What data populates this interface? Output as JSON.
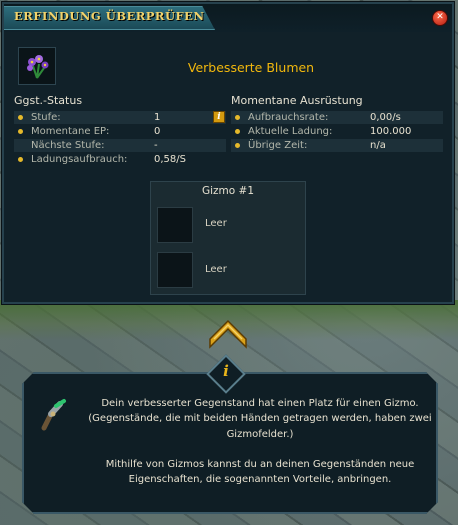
{
  "window": {
    "title": "ERFINDUNG ÜBERPRÜFEN",
    "close_icon": "close-icon",
    "accent": "#f2b80d"
  },
  "item": {
    "name": "Verbesserte Blumen",
    "icon": "flowers-icon"
  },
  "item_status": {
    "heading": "Ggst.-Status",
    "rows": [
      {
        "label": "Stufe:",
        "value": "1",
        "bullet": true,
        "info_icon": true
      },
      {
        "label": "Momentane EP:",
        "value": "0",
        "bullet": true
      },
      {
        "label": "Nächste Stufe:",
        "value": "-",
        "bullet": false
      },
      {
        "label": "Ladungsaufbrauch:",
        "value": "0,58/S",
        "bullet": true
      }
    ]
  },
  "current_equipment": {
    "heading": "Momentane Ausrüstung",
    "rows": [
      {
        "label": "Aufbrauchsrate:",
        "value": "0,00/s",
        "bullet": true
      },
      {
        "label": "Aktuelle Ladung:",
        "value": "100.000",
        "bullet": true
      },
      {
        "label": "Übrige Zeit:",
        "value": "n/a",
        "bullet": true
      }
    ]
  },
  "gizmo": {
    "title": "Gizmo #1",
    "slots": [
      {
        "label": "Leer"
      },
      {
        "label": "Leer"
      }
    ]
  },
  "arrow": {
    "icon": "chevron-up-icon"
  },
  "info": {
    "icon": "info-icon",
    "tool_icon": "invention-tool-icon",
    "paragraph1": "Dein verbesserter Gegenstand hat einen Platz für einen Gizmo. (Gegenstände, die mit beiden Händen getragen werden, haben zwei Gizmofelder.)",
    "paragraph2": "Mithilfe von Gizmos kannst du an deinen Gegenständen neue Eigenschaften, die sogenannten Vorteile, anbringen."
  }
}
